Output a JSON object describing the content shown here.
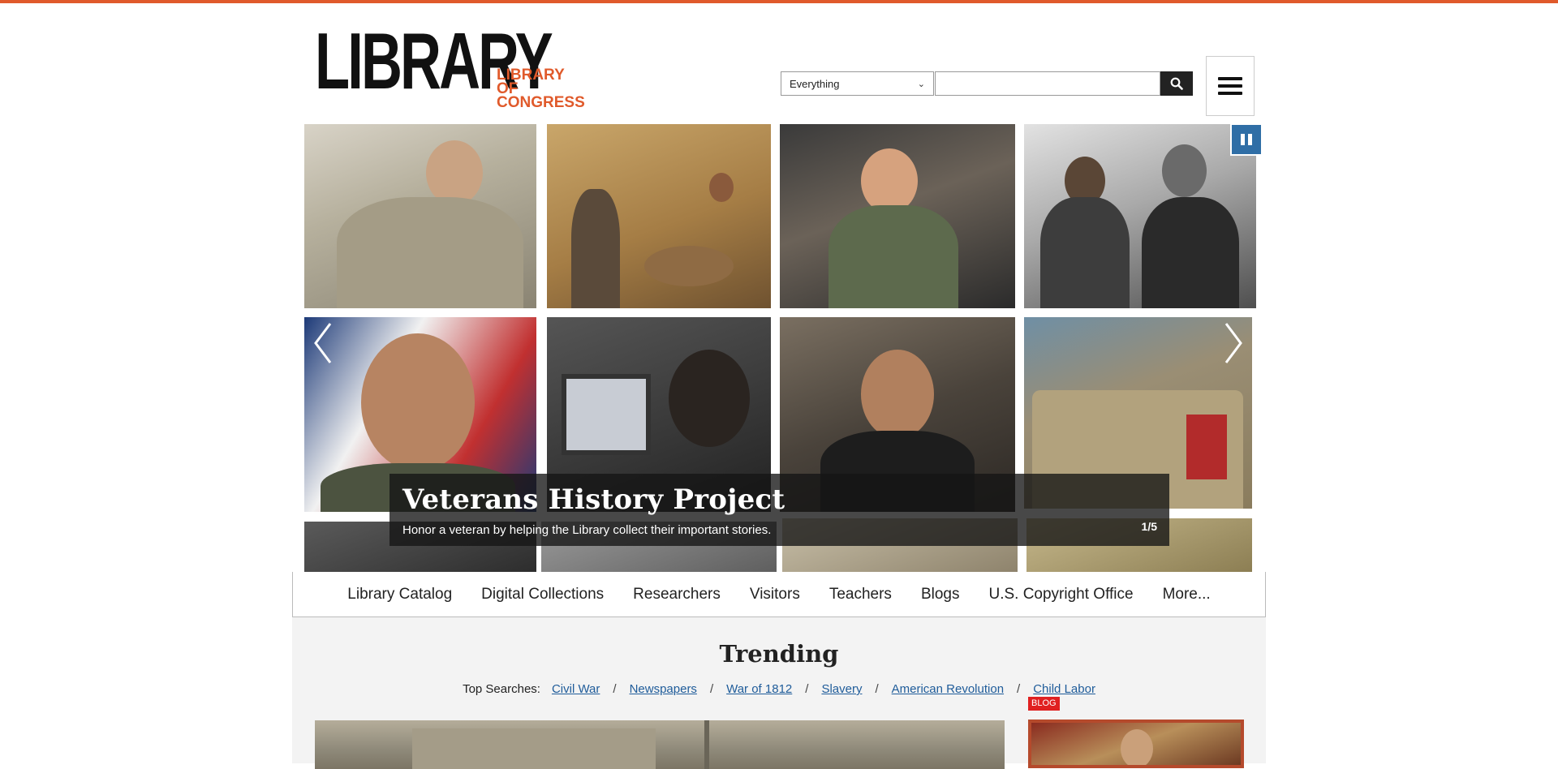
{
  "header": {
    "logo_main": "LIBRARY",
    "logo_sub_line1": "LIBRARY",
    "logo_sub_line2": "OF CONGRESS",
    "search_filter_selected": "Everything",
    "search_placeholder": ""
  },
  "colors": {
    "accent": "#e05a2b",
    "pause_button": "#2f6ea6",
    "link": "#1f5c9a"
  },
  "icons": {
    "search": "search-icon",
    "menu": "menu-icon",
    "pause": "pause-icon",
    "previous": "chevron-left-icon",
    "next": "chevron-right-icon"
  },
  "hero": {
    "title": "Veterans History Project",
    "text": "Honor a veteran by helping the Library collect their important stories.",
    "counter": "1/5"
  },
  "nav": {
    "items": [
      "Library Catalog",
      "Digital Collections",
      "Researchers",
      "Visitors",
      "Teachers",
      "Blogs",
      "U.S. Copyright Office",
      "More..."
    ]
  },
  "trending": {
    "title": "Trending",
    "top_searches_label": "Top Searches:",
    "links": [
      "Civil War",
      "Newspapers",
      "War of 1812",
      "Slavery",
      "American Revolution",
      "Child Labor"
    ],
    "blog_label": "BLOG"
  }
}
